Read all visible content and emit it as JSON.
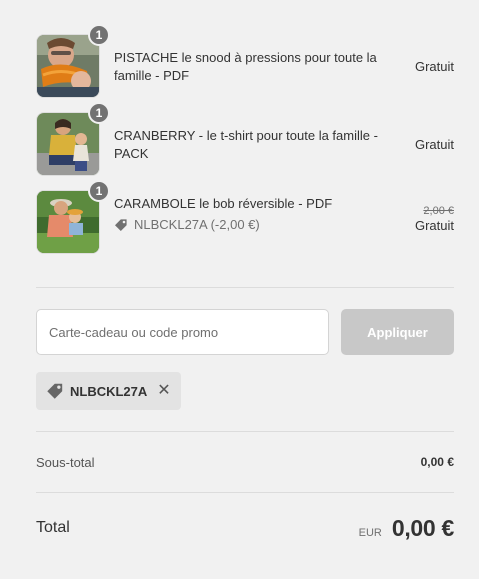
{
  "items": [
    {
      "title": "PISTACHE le snood à pressions pour toute la famille - PDF",
      "quantity": "1",
      "price": "Gratuit",
      "image": "photo-man-child-orange-snood"
    },
    {
      "title": "CRANBERRY - le t-shirt pour toute la famille - PACK",
      "quantity": "1",
      "price": "Gratuit",
      "image": "photo-woman-child-tshirts"
    },
    {
      "title": "CARAMBOLE le bob réversible - PDF",
      "quantity": "1",
      "discount": "NLBCKL27A (-2,00 €)",
      "old_price": "2,00 €",
      "price": "Gratuit",
      "image": "photo-woman-child-garden"
    }
  ],
  "promo": {
    "placeholder": "Carte-cadeau ou code promo",
    "value": "",
    "apply_label": "Appliquer",
    "applied_code": "NLBCKL27A"
  },
  "summary": {
    "subtotal_label": "Sous-total",
    "subtotal_value": "0,00 €",
    "total_label": "Total",
    "currency": "EUR",
    "total_value": "0,00 €"
  },
  "colors": {
    "background": "#f1f1f1",
    "badge": "#727272",
    "button_disabled": "#c8c8c8",
    "chip": "#e3e3e3"
  }
}
